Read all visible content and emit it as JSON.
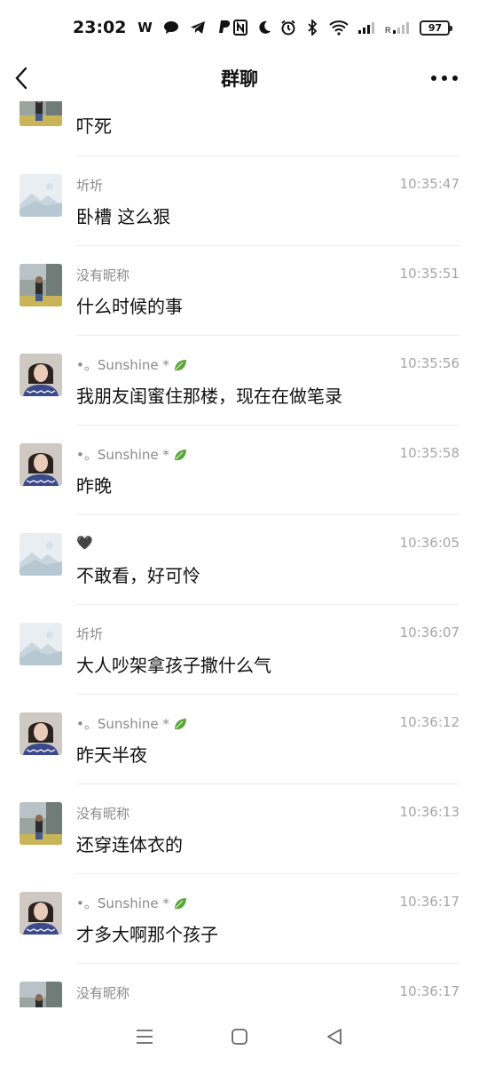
{
  "status_bar": {
    "time": "23:02",
    "app_icons": [
      "W"
    ],
    "battery": "97"
  },
  "header": {
    "title": "群聊"
  },
  "messages": [
    {
      "sender": "",
      "time": "",
      "text": "吓死",
      "avatar": "photo-child"
    },
    {
      "sender": "圻圻",
      "time": "10:35:47",
      "text": "卧槽 这么狠",
      "avatar": "landscape"
    },
    {
      "sender": "没有昵称",
      "time": "10:35:51",
      "text": "什么时候的事",
      "avatar": "photo-child"
    },
    {
      "sender": "•。Sunshine *",
      "time": "10:35:56",
      "text": "我朋友闺蜜住那楼，现在在做笔录",
      "avatar": "photo-woman",
      "leaf": true
    },
    {
      "sender": "•。Sunshine *",
      "time": "10:35:58",
      "text": "昨晚",
      "avatar": "photo-woman",
      "leaf": true
    },
    {
      "sender": "🖤",
      "time": "10:36:05",
      "text": "不敢看，好可怜",
      "avatar": "landscape"
    },
    {
      "sender": "圻圻",
      "time": "10:36:07",
      "text": "大人吵架拿孩子撒什么气",
      "avatar": "landscape"
    },
    {
      "sender": "•。Sunshine *",
      "time": "10:36:12",
      "text": "昨天半夜",
      "avatar": "photo-woman",
      "leaf": true
    },
    {
      "sender": "没有昵称",
      "time": "10:36:13",
      "text": "还穿连体衣的",
      "avatar": "photo-child"
    },
    {
      "sender": "•。Sunshine *",
      "time": "10:36:17",
      "text": "才多大啊那个孩子",
      "avatar": "photo-woman",
      "leaf": true
    },
    {
      "sender": "没有昵称",
      "time": "10:36:17",
      "text": "",
      "avatar": "photo-child"
    }
  ]
}
